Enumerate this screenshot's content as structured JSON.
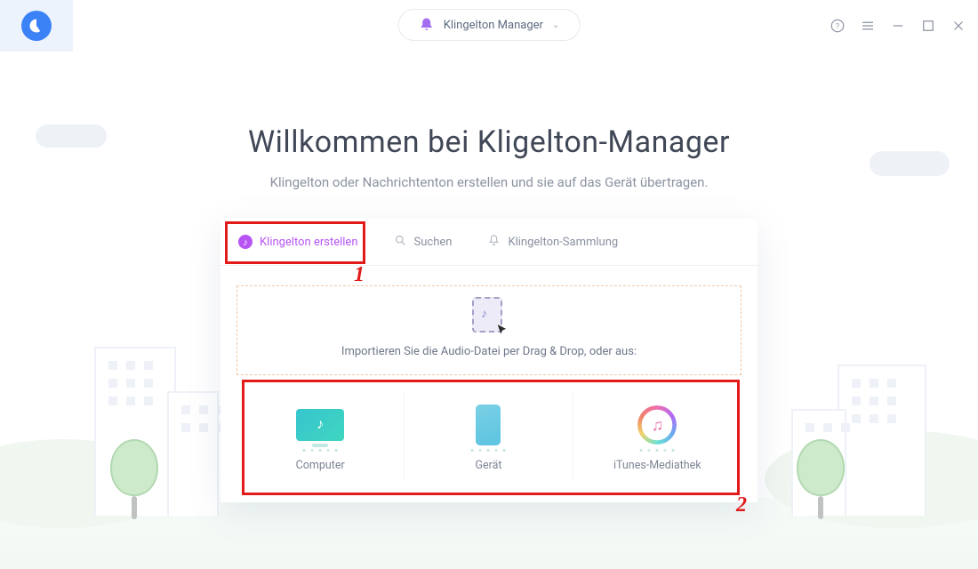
{
  "header": {
    "mode_label": "Klingelton Manager"
  },
  "heading": {
    "title": "Willkommen bei Kligelton-Manager",
    "subtitle": "Klingelton oder Nachrichtenton erstellen und sie auf das Gerät übertragen."
  },
  "tabs": {
    "create": "Klingelton erstellen",
    "search": "Suchen",
    "collection": "Klingelton-Sammlung"
  },
  "dropzone": {
    "text": "Importieren Sie die Audio-Datei per Drag & Drop, oder aus:"
  },
  "sources": {
    "computer": "Computer",
    "device": "Gerät",
    "itunes": "iTunes-Mediathek"
  },
  "annotations": {
    "n1": "1",
    "n2": "2"
  }
}
